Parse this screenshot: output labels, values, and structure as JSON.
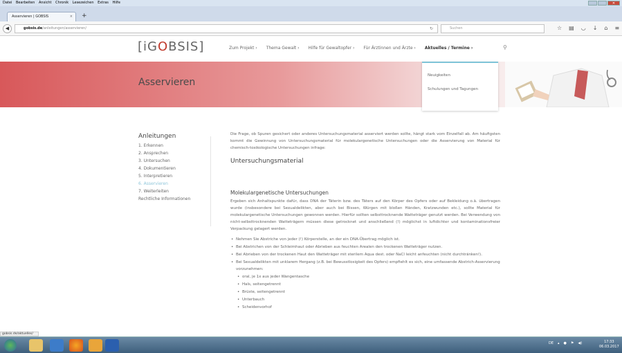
{
  "browser": {
    "menu": [
      "Datei",
      "Bearbeiten",
      "Ansicht",
      "Chronik",
      "Lesezeichen",
      "Extras",
      "Hilfe"
    ],
    "tab_title": "Asservieren | GOBSIS",
    "tab_close": "×",
    "new_tab": "+",
    "url_domain": "gobsis.de",
    "url_path": "/anleitungen/asservieren/",
    "search_placeholder": "Suchen",
    "status_url": "gobsis.de/aktuelles/"
  },
  "site": {
    "logo_prefix": "[iG",
    "logo_o": "O",
    "logo_suffix": "BSIS]",
    "nav": [
      "Zum Projekt ›",
      "Thema Gewalt ›",
      "Hilfe für Gewaltopfer ›",
      "Für Ärztinnen und Ärzte ›",
      "Aktuelles / Termine ›"
    ],
    "dropdown": [
      "Neuigkeiten",
      "Schulungen und Tagungen"
    ],
    "hero_title": "Asservieren"
  },
  "sidebar": {
    "heading": "Anleitungen",
    "items": [
      "1. Erkennen",
      "2. Ansprechen",
      "3. Untersuchen",
      "4. Dokumentieren",
      "5. Interpretieren",
      "6. Asservieren",
      "7. Weiterleiten",
      "Rechtliche Informationen"
    ]
  },
  "content": {
    "intro": "Die Frage, ob Spuren gesichert oder anderes Untersuchungsmaterial asserviert werden sollte, hängt stark vom Einzelfall ab. Am häufigsten kommt die Gewinnung von Untersuchungsmaterial für molekulargenetische Untersuchungen oder die Asservierung von Material für chemisch-toxikologische Untersuchungen infrage:",
    "h2": "Untersuchungsmaterial",
    "h3": "Molekulargenetische Untersuchungen",
    "para": "Ergeben sich Anhaltspunkte dafür, dass DNA der Täterin bzw. des Täters auf den Körper des Opfers oder auf Bekleidung o.ä. übertragen wurde (insbesondere bei Sexualdelikten, aber auch bei Bissen, Würgen mit bloßen Händen, Kratzwunden etc.), sollte Material für molekulargenetische Untersuchungen gewonnen werden. Hierfür sollten selbsttrocknende Watteträger genutzt werden. Bei Verwendung von nicht-selbsttrocknenden Watteträgern müssen diese getrocknet und anschließend (!) möglichst in luftdichter und kontaminationsfreier Verpackung gelagert werden.",
    "bullets": [
      "Nehmen Sie Abstriche von jeder (!) Körperstelle, an der ein DNA-Übertrag möglich ist.",
      "Bei Abstrichen von der Schleimhaut oder Abrieben aus feuchten Arealen den trockenen Watteträger nutzen.",
      "Bei Abrieben von der trockenen Haut den Watteträger mit sterilem Aqua dest. oder NaCl leicht anfeuchten (nicht durchtränken!).",
      "Bei Sexualdelikten mit unklarem Hergang (z.B. bei Bewusstlosigkeit des Opfers) empfiehlt es sich, eine umfassende Abstrich-Asservierung vorzunehmen:"
    ],
    "subbullets": [
      "oral, je 1x aus jeder Wangentasche",
      "Hals, seitengetrennt",
      "Brüste, seitengetrennt",
      "Unterbauch",
      "Scheidenvorhof"
    ]
  },
  "taskbar": {
    "lang": "DE",
    "time": "17:33",
    "date": "06.03.2017"
  }
}
